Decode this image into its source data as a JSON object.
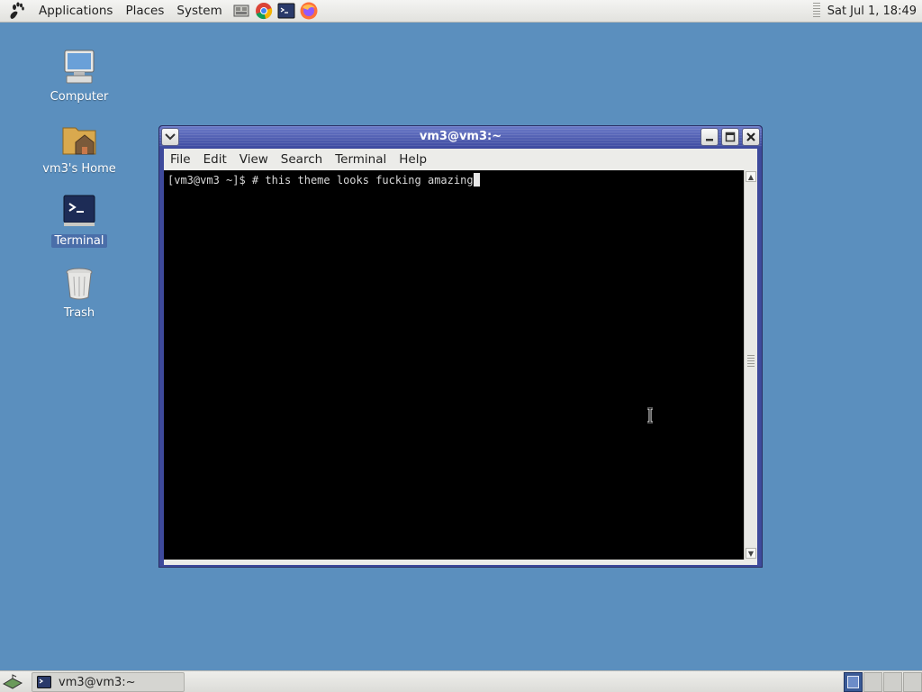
{
  "top_panel": {
    "menus": [
      "Applications",
      "Places",
      "System"
    ],
    "launchers": [
      "file-manager-icon",
      "chrome-icon",
      "terminal-launcher-icon",
      "firefox-icon"
    ],
    "clock": "Sat Jul  1, 18:49"
  },
  "desktop": {
    "icons": [
      {
        "label": "Computer"
      },
      {
        "label": "vm3's Home"
      },
      {
        "label": "Terminal",
        "selected": true
      },
      {
        "label": "Trash"
      }
    ]
  },
  "window": {
    "title": "vm3@vm3:~",
    "menus": [
      "File",
      "Edit",
      "View",
      "Search",
      "Terminal",
      "Help"
    ],
    "terminal_text": "[vm3@vm3 ~]$ # this theme looks fucking amazing"
  },
  "bottom_panel": {
    "task_label": "vm3@vm3:~",
    "workspace_count": 4,
    "active_workspace": 1
  },
  "colors": {
    "desktop_bg": "#5b8fbe",
    "titlebar": "#3d4aa0",
    "terminal_bg": "#000000",
    "terminal_fg": "#d8d8d8"
  }
}
